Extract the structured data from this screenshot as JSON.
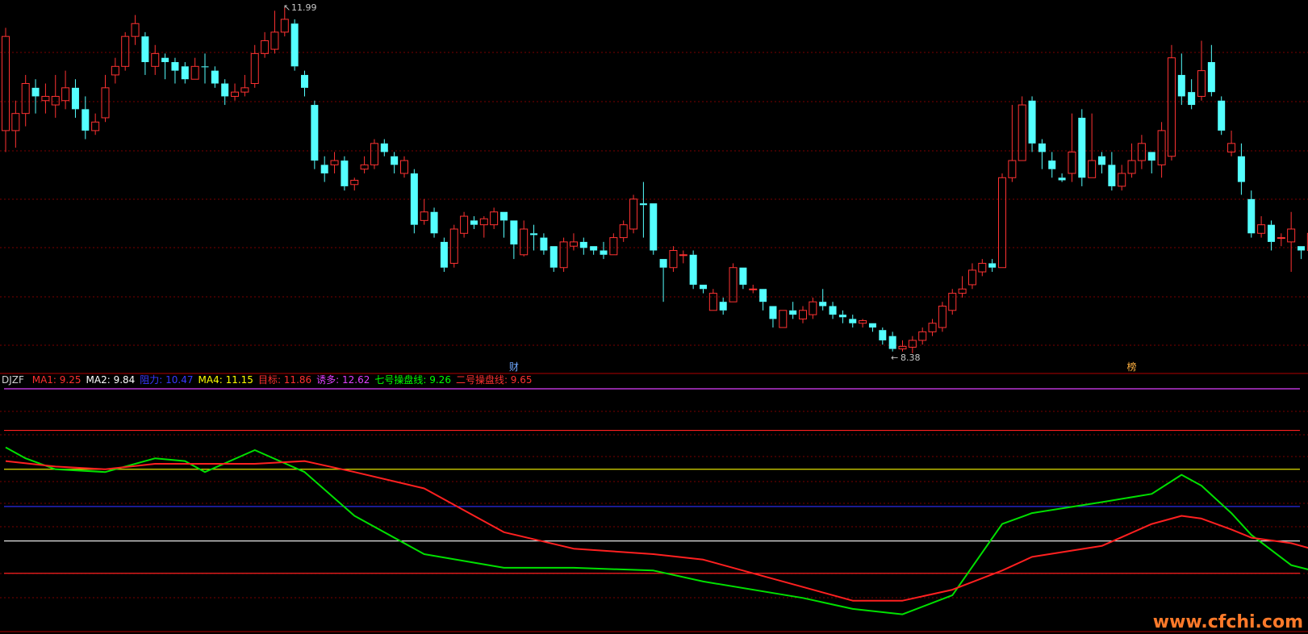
{
  "chart_data": {
    "type": "candlestick",
    "main_panel": {
      "high_label": "11.99",
      "low_label": "8.38",
      "event_markers": [
        {
          "label": "财",
          "index": 51,
          "color": "#6fa8ff"
        },
        {
          "label": "榜",
          "index": 113,
          "color": "#ffb040"
        }
      ],
      "candles": [
        [
          10.55,
          11.65,
          11.75,
          10.3
        ],
        [
          10.55,
          10.75,
          10.9,
          10.35
        ],
        [
          10.75,
          11.1,
          11.2,
          10.6
        ],
        [
          11.05,
          10.95,
          11.15,
          10.75
        ],
        [
          10.9,
          10.95,
          11.1,
          10.75
        ],
        [
          10.85,
          10.95,
          11.2,
          10.7
        ],
        [
          10.9,
          11.05,
          11.25,
          10.8
        ],
        [
          11.05,
          10.8,
          11.15,
          10.7
        ],
        [
          10.8,
          10.55,
          10.95,
          10.45
        ],
        [
          10.55,
          10.65,
          10.75,
          10.5
        ],
        [
          10.7,
          11.05,
          11.2,
          10.65
        ],
        [
          11.2,
          11.3,
          11.4,
          11.1
        ],
        [
          11.3,
          11.65,
          11.7,
          11.25
        ],
        [
          11.65,
          11.8,
          11.9,
          11.55
        ],
        [
          11.65,
          11.35,
          11.7,
          11.2
        ],
        [
          11.3,
          11.45,
          11.55,
          11.2
        ],
        [
          11.4,
          11.35,
          11.45,
          11.15
        ],
        [
          11.35,
          11.25,
          11.4,
          11.1
        ],
        [
          11.3,
          11.15,
          11.35,
          11.1
        ],
        [
          11.15,
          11.3,
          11.4,
          11.15
        ],
        [
          11.3,
          11.29,
          11.45,
          11.1
        ],
        [
          11.25,
          11.1,
          11.3,
          11.05
        ],
        [
          11.1,
          10.95,
          11.15,
          10.85
        ],
        [
          10.95,
          11.0,
          11.1,
          10.9
        ],
        [
          11.0,
          11.05,
          11.2,
          10.95
        ],
        [
          11.1,
          11.45,
          11.55,
          11.05
        ],
        [
          11.45,
          11.6,
          11.7,
          11.4
        ],
        [
          11.5,
          11.7,
          11.95,
          11.45
        ],
        [
          11.7,
          11.85,
          11.99,
          11.65
        ],
        [
          11.8,
          11.3,
          11.85,
          11.25
        ],
        [
          11.2,
          11.05,
          11.25,
          10.95
        ],
        [
          10.85,
          10.2,
          10.9,
          10.1
        ],
        [
          10.15,
          10.05,
          10.25,
          9.95
        ],
        [
          10.15,
          10.2,
          10.3,
          10.05
        ],
        [
          10.2,
          9.9,
          10.25,
          9.85
        ],
        [
          9.92,
          9.97,
          10.0,
          9.85
        ],
        [
          10.1,
          10.15,
          10.25,
          10.05
        ],
        [
          10.15,
          10.4,
          10.45,
          10.1
        ],
        [
          10.4,
          10.3,
          10.45,
          10.25
        ],
        [
          10.25,
          10.15,
          10.3,
          10.05
        ],
        [
          10.05,
          10.2,
          10.25,
          10.0
        ],
        [
          10.05,
          9.45,
          10.1,
          9.35
        ],
        [
          9.5,
          9.6,
          9.75,
          9.45
        ],
        [
          9.6,
          9.35,
          9.65,
          9.3
        ],
        [
          9.25,
          8.95,
          9.3,
          8.9
        ],
        [
          9.0,
          9.4,
          9.45,
          8.95
        ],
        [
          9.35,
          9.55,
          9.6,
          9.3
        ],
        [
          9.5,
          9.45,
          9.55,
          9.4
        ],
        [
          9.45,
          9.52,
          9.55,
          9.3
        ],
        [
          9.45,
          9.6,
          9.65,
          9.4
        ],
        [
          9.6,
          9.5,
          9.6,
          9.3
        ],
        [
          9.5,
          9.22,
          9.5,
          9.05
        ],
        [
          9.1,
          9.4,
          9.5,
          9.08
        ],
        [
          9.35,
          9.33,
          9.45,
          9.15
        ],
        [
          9.3,
          9.15,
          9.35,
          9.1
        ],
        [
          9.2,
          8.95,
          9.2,
          8.9
        ],
        [
          8.95,
          9.25,
          9.3,
          8.9
        ],
        [
          9.2,
          9.25,
          9.35,
          9.15
        ],
        [
          9.25,
          9.18,
          9.3,
          9.1
        ],
        [
          9.2,
          9.15,
          9.2,
          9.1
        ],
        [
          9.15,
          9.1,
          9.25,
          9.05
        ],
        [
          9.1,
          9.3,
          9.35,
          9.1
        ],
        [
          9.3,
          9.45,
          9.5,
          9.25
        ],
        [
          9.4,
          9.75,
          9.8,
          9.35
        ],
        [
          9.7,
          9.68,
          9.95,
          9.3
        ],
        [
          9.7,
          9.15,
          9.7,
          9.1
        ],
        [
          9.05,
          8.95,
          9.05,
          8.55
        ],
        [
          8.95,
          9.15,
          9.2,
          8.9
        ],
        [
          9.1,
          9.1,
          9.15,
          9.0
        ],
        [
          9.1,
          8.75,
          9.15,
          8.7
        ],
        [
          8.75,
          8.7,
          8.75,
          8.65
        ],
        [
          8.45,
          8.65,
          8.7,
          8.45
        ],
        [
          8.55,
          8.45,
          8.6,
          8.4
        ],
        [
          8.55,
          8.95,
          9.0,
          8.55
        ],
        [
          8.95,
          8.75,
          8.95,
          8.7
        ],
        [
          8.7,
          8.7,
          8.75,
          8.65
        ],
        [
          8.7,
          8.55,
          8.7,
          8.45
        ],
        [
          8.5,
          8.35,
          8.5,
          8.25
        ],
        [
          8.25,
          8.45,
          8.45,
          8.25
        ],
        [
          8.45,
          8.4,
          8.55,
          8.35
        ],
        [
          8.35,
          8.45,
          8.5,
          8.3
        ],
        [
          8.4,
          8.55,
          8.6,
          8.35
        ],
        [
          8.55,
          8.5,
          8.7,
          8.45
        ],
        [
          8.5,
          8.4,
          8.55,
          8.35
        ],
        [
          8.4,
          8.37,
          8.45,
          8.3
        ],
        [
          8.35,
          8.3,
          8.4,
          8.25
        ],
        [
          8.3,
          8.33,
          8.35,
          8.25
        ],
        [
          8.3,
          8.25,
          8.3,
          8.2
        ],
        [
          8.22,
          8.1,
          8.25,
          8.05
        ],
        [
          8.15,
          8.0,
          8.2,
          7.97
        ],
        [
          8.0,
          8.03,
          8.1,
          7.97
        ],
        [
          8.02,
          8.1,
          8.15,
          7.95
        ],
        [
          8.1,
          8.2,
          8.25,
          8.05
        ],
        [
          8.2,
          8.3,
          8.35,
          8.15
        ],
        [
          8.25,
          8.5,
          8.55,
          8.2
        ],
        [
          8.45,
          8.65,
          8.7,
          8.4
        ],
        [
          8.65,
          8.7,
          8.85,
          8.6
        ],
        [
          8.75,
          8.92,
          9.0,
          8.7
        ],
        [
          8.9,
          9.0,
          9.05,
          8.85
        ],
        [
          9.0,
          8.95,
          9.05,
          8.9
        ],
        [
          8.95,
          10.0,
          10.05,
          8.95
        ],
        [
          10.0,
          10.2,
          10.85,
          9.95
        ],
        [
          10.2,
          10.85,
          10.95,
          10.2
        ],
        [
          10.9,
          10.4,
          10.95,
          10.3
        ],
        [
          10.4,
          10.3,
          10.45,
          10.1
        ],
        [
          10.2,
          10.1,
          10.3,
          10.0
        ],
        [
          10.0,
          9.97,
          10.05,
          9.95
        ],
        [
          10.05,
          10.3,
          10.75,
          9.95
        ],
        [
          10.7,
          10.0,
          10.8,
          9.9
        ],
        [
          10.0,
          10.2,
          10.75,
          10.0
        ],
        [
          10.25,
          10.15,
          10.3,
          10.05
        ],
        [
          10.15,
          9.9,
          10.3,
          9.85
        ],
        [
          9.9,
          10.05,
          10.15,
          9.85
        ],
        [
          10.05,
          10.2,
          10.4,
          10.0
        ],
        [
          10.2,
          10.4,
          10.5,
          10.1
        ],
        [
          10.3,
          10.2,
          10.3,
          10.05
        ],
        [
          10.15,
          10.55,
          10.65,
          10.0
        ],
        [
          10.25,
          11.4,
          11.55,
          10.2
        ],
        [
          11.2,
          10.95,
          11.45,
          10.85
        ],
        [
          11.0,
          10.85,
          11.15,
          10.8
        ],
        [
          10.95,
          11.25,
          11.6,
          10.9
        ],
        [
          11.35,
          11.0,
          11.55,
          10.95
        ],
        [
          10.9,
          10.55,
          10.95,
          10.5
        ],
        [
          10.3,
          10.4,
          10.55,
          10.25
        ],
        [
          10.25,
          9.95,
          10.4,
          9.8
        ],
        [
          9.75,
          9.35,
          9.85,
          9.3
        ],
        [
          9.35,
          9.45,
          9.55,
          9.3
        ],
        [
          9.45,
          9.25,
          9.5,
          9.15
        ],
        [
          9.3,
          9.3,
          9.35,
          9.2
        ],
        [
          9.25,
          9.4,
          9.6,
          8.9
        ],
        [
          9.2,
          9.15,
          9.2,
          9.05
        ],
        [
          9.15,
          9.35,
          9.4,
          9.1
        ],
        [
          9.3,
          9.45,
          9.55,
          9.2
        ]
      ]
    },
    "indicator_panel": {
      "name": "DJZF",
      "legend": [
        {
          "label": "MA1:",
          "value": "9.25",
          "color": "#ff3030"
        },
        {
          "label": "MA2:",
          "value": "9.84",
          "color": "#ffffff"
        },
        {
          "label": "阻力:",
          "value": "10.47",
          "color": "#3838ff"
        },
        {
          "label": "MA4:",
          "value": "11.15",
          "color": "#ffff00"
        },
        {
          "label": "目标:",
          "value": "11.86",
          "color": "#ff3030"
        },
        {
          "label": "诱多:",
          "value": "12.62",
          "color": "#e040ff"
        },
        {
          "label": "七号操盘线:",
          "value": "9.26",
          "color": "#00ff00"
        },
        {
          "label": "二号操盘线:",
          "value": "9.65",
          "color": "#ff3030"
        }
      ],
      "horizontal_levels": [
        {
          "name": "诱多",
          "value": 12.62,
          "color": "#e040ff"
        },
        {
          "name": "目标",
          "value": 11.86,
          "color": "#ff2020"
        },
        {
          "name": "MA4",
          "value": 11.15,
          "color": "#e0e000"
        },
        {
          "name": "阻力",
          "value": 10.47,
          "color": "#3030ff"
        },
        {
          "name": "MA2",
          "value": 9.84,
          "color": "#ffffff"
        },
        {
          "name": "MA1",
          "value": 9.25,
          "color": "#ff2020"
        }
      ],
      "series": [
        {
          "name": "七号操盘线",
          "color": "#00e000",
          "x": [
            0,
            2,
            5,
            10,
            15,
            18,
            20,
            25,
            30,
            35,
            42,
            50,
            57,
            65,
            70,
            80,
            85,
            90,
            95,
            100,
            103,
            110,
            115,
            118,
            120,
            123,
            125,
            129,
            132
          ],
          "y": [
            11.55,
            11.35,
            11.15,
            11.1,
            11.35,
            11.3,
            11.1,
            11.5,
            11.1,
            10.3,
            9.6,
            9.35,
            9.35,
            9.3,
            9.1,
            8.8,
            8.6,
            8.5,
            8.85,
            10.15,
            10.35,
            10.55,
            10.7,
            11.05,
            10.85,
            10.35,
            9.95,
            9.4,
            9.26
          ]
        },
        {
          "name": "二号操盘线",
          "color": "#ff2020",
          "x": [
            0,
            5,
            10,
            15,
            20,
            25,
            30,
            35,
            42,
            50,
            57,
            65,
            70,
            80,
            85,
            90,
            95,
            100,
            103,
            110,
            115,
            118,
            120,
            123,
            125,
            129,
            132
          ],
          "y": [
            11.3,
            11.2,
            11.15,
            11.25,
            11.25,
            11.25,
            11.3,
            11.1,
            10.8,
            10.0,
            9.7,
            9.6,
            9.5,
            9.0,
            8.75,
            8.75,
            8.95,
            9.3,
            9.55,
            9.75,
            10.15,
            10.3,
            10.25,
            10.05,
            9.9,
            9.8,
            9.65
          ]
        }
      ]
    }
  },
  "watermark": "www.cfchi.com"
}
